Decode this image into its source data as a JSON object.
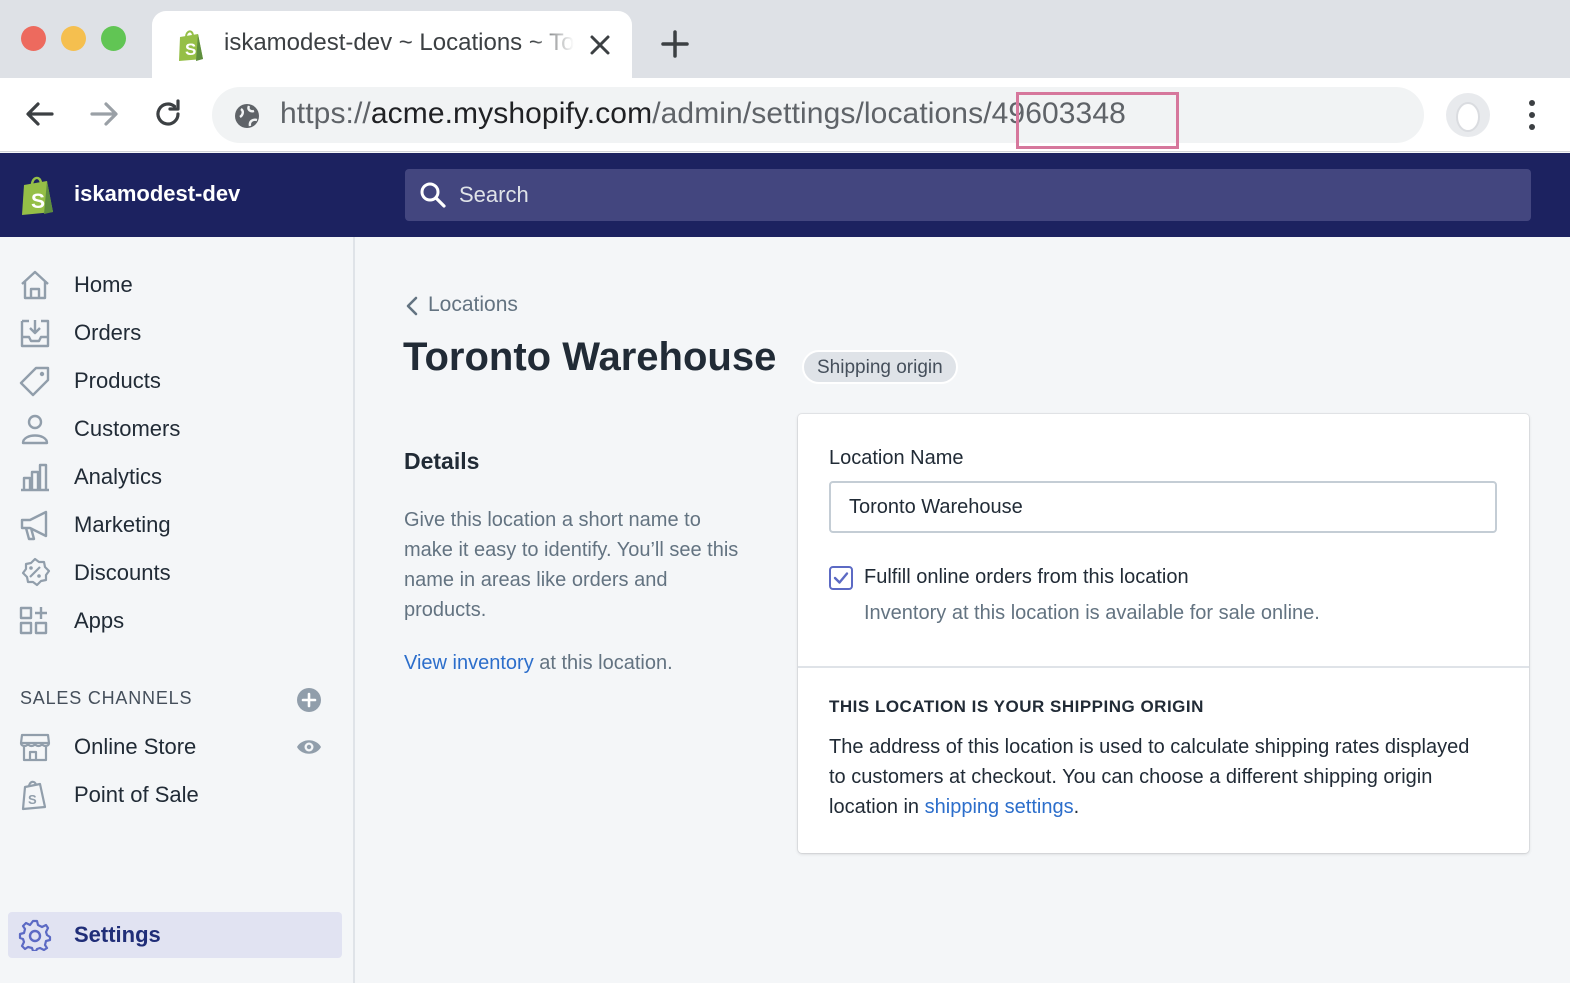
{
  "browser": {
    "tab_title": "iskamodest-dev ~ Locations ~ Toronto Warehouse",
    "url_prefix": "https://",
    "url_host": "acme.myshopify.com",
    "url_path": "/admin/settings/locations",
    "url_id": "/49603348",
    "highlight_color": "#d6779c"
  },
  "topbar": {
    "shop_name": "iskamodest-dev",
    "search_placeholder": "Search",
    "background_color": "#1c2260"
  },
  "sidebar": {
    "items": [
      {
        "label": "Home",
        "icon": "home-icon"
      },
      {
        "label": "Orders",
        "icon": "orders-icon"
      },
      {
        "label": "Products",
        "icon": "tag-icon"
      },
      {
        "label": "Customers",
        "icon": "person-icon"
      },
      {
        "label": "Analytics",
        "icon": "bar-chart-icon"
      },
      {
        "label": "Marketing",
        "icon": "megaphone-icon"
      },
      {
        "label": "Discounts",
        "icon": "discount-icon"
      },
      {
        "label": "Apps",
        "icon": "apps-icon"
      }
    ],
    "sales_channels_heading": "SALES CHANNELS",
    "channels": [
      {
        "label": "Online Store",
        "icon": "store-icon"
      },
      {
        "label": "Point of Sale",
        "icon": "pos-icon"
      }
    ],
    "settings_label": "Settings"
  },
  "main": {
    "breadcrumb": "Locations",
    "title": "Toronto Warehouse",
    "badge": "Shipping origin",
    "details": {
      "heading": "Details",
      "description": "Give this location a short name to make it easy to identify. You’ll see this name in areas like orders and products.",
      "link_text": "View inventory",
      "link_suffix": " at this location."
    },
    "card": {
      "field_label": "Location Name",
      "field_value": "Toronto Warehouse",
      "checkbox_checked": true,
      "checkbox_label": "Fulfill online orders from this location",
      "checkbox_help": "Inventory at this location is available for sale online.",
      "origin_heading": "THIS LOCATION IS YOUR SHIPPING ORIGIN",
      "origin_text": "The address of this location is used to calculate shipping rates displayed to customers at checkout. You can choose a different shipping origin location in ",
      "origin_link": "shipping settings",
      "origin_end": "."
    },
    "accent_color": "#5c6ac4",
    "link_color": "#2c6ecb"
  }
}
